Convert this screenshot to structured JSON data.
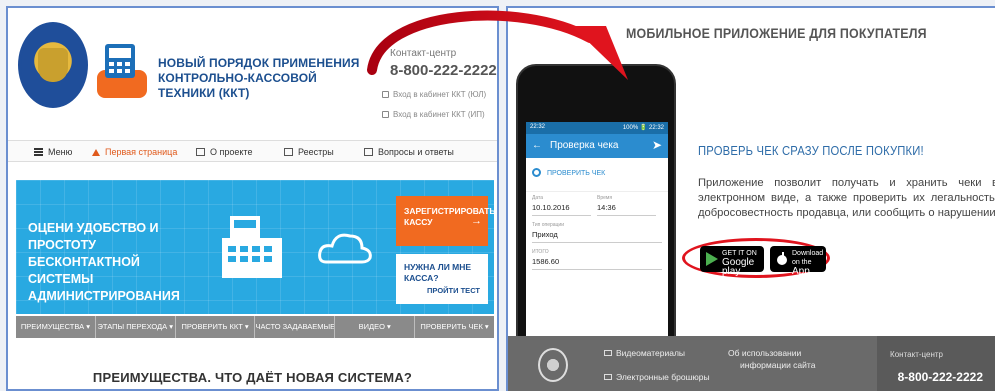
{
  "colors": {
    "brand_blue": "#1c4f8f",
    "banner_blue": "#29a9e1",
    "accent_orange": "#f16a20",
    "arrow_red": "#e0141e",
    "panel_border": "#6b8fd0"
  },
  "left": {
    "title": "НОВЫЙ ПОРЯДОК ПРИМЕНЕНИЯ КОНТРОЛЬНО-КАССОВОЙ ТЕХНИКИ (ККТ)",
    "contact_label": "Контакт-центр",
    "phone": "8-800-222-2222",
    "login_ul": "Вход в кабинет ККТ (ЮЛ)",
    "login_ip": "Вход в кабинет ККТ (ИП)",
    "nav": [
      {
        "label": "Меню",
        "icon": "menu-icon"
      },
      {
        "label": "Первая страница",
        "icon": "home-icon"
      },
      {
        "label": "О проекте",
        "icon": "document-icon"
      },
      {
        "label": "Реестры",
        "icon": "list-icon"
      },
      {
        "label": "Вопросы и ответы",
        "icon": "chat-icon"
      }
    ],
    "banner": {
      "headline": "ОЦЕНИ УДОБСТВО И ПРОСТОТУ БЕСКОНТАКТНОЙ СИСТЕМЫ АДМИНИСТРИРОВАНИЯ",
      "register_button": "ЗАРЕГИСТРИРОВАТЬ КАССУ",
      "need_question": "НУЖНА ЛИ МНЕ КАССА?",
      "test_button": "ПРОЙТИ ТЕСТ"
    },
    "tabs": [
      "ПРЕИМУЩЕСТВА ▾",
      "ЭТАПЫ ПЕРЕХОДА ▾",
      "ПРОВЕРИТЬ ККТ ▾",
      "ЧАСТО ЗАДАВАЕМЫЕ ВОПРОСЫ ▾",
      "ВИДЕО ▾",
      "ПРОВЕРИТЬ ЧЕК ▾"
    ],
    "bottom_title": "ПРЕИМУЩЕСТВА. ЧТО ДАЁТ НОВАЯ СИСТЕМА?"
  },
  "right": {
    "title": "МОБИЛЬНОЕ ПРИЛОЖЕНИЕ ДЛЯ ПОКУПАТЕЛЯ",
    "phone_ui": {
      "status_time": "22:32",
      "status_right": "100% 🔋 22:32",
      "screen_title": "Проверка чека",
      "search_label": "ПРОВЕРИТЬ ЧЕК",
      "date_label": "Дата",
      "date_value": "10.10.2016",
      "time_label": "Время",
      "time_value": "14:36",
      "op_label": "Тип операции",
      "op_value": "Приход",
      "total_label": "ИТОГО",
      "total_value": "1586.60"
    },
    "subtitle": "ПРОВЕРЬ ЧЕК СРАЗУ ПОСЛЕ ПОКУПКИ!",
    "description": "Приложение позволит получать и хранить чеки в электронном виде, а также проверить их легальность, добросовестность продавца, или сообщить о нарушении",
    "google_play_small": "GET IT ON",
    "google_play": "Google play",
    "app_store_small": "Download on the",
    "app_store": "App Store",
    "footer": {
      "video": "Видеоматериалы",
      "brochures": "Электронные брошюры",
      "info_line1": "Об использовании",
      "info_line2": "информации сайта",
      "contact_label": "Контакт-центр",
      "phone": "8-800-222-2222"
    }
  }
}
